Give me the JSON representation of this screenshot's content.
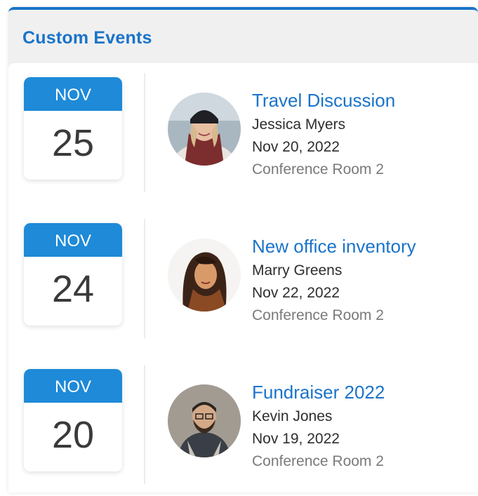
{
  "panel": {
    "title": "Custom Events"
  },
  "events": [
    {
      "month": "NOV",
      "day": "25",
      "title": "Travel Discussion",
      "person": "Jessica Myers",
      "date": "Nov 20, 2022",
      "room": "Conference Room 2"
    },
    {
      "month": "NOV",
      "day": "24",
      "title": "New office inventory",
      "person": "Marry Greens",
      "date": "Nov 22, 2022",
      "room": "Conference Room 2"
    },
    {
      "month": "NOV",
      "day": "20",
      "title": "Fundraiser 2022",
      "person": "Kevin Jones",
      "date": "Nov 19, 2022",
      "room": "Conference Room 2"
    }
  ],
  "colors": {
    "accent": "#1a73c9",
    "month_header": "#1e8ad8",
    "panel_bg": "#f0f0f0"
  }
}
